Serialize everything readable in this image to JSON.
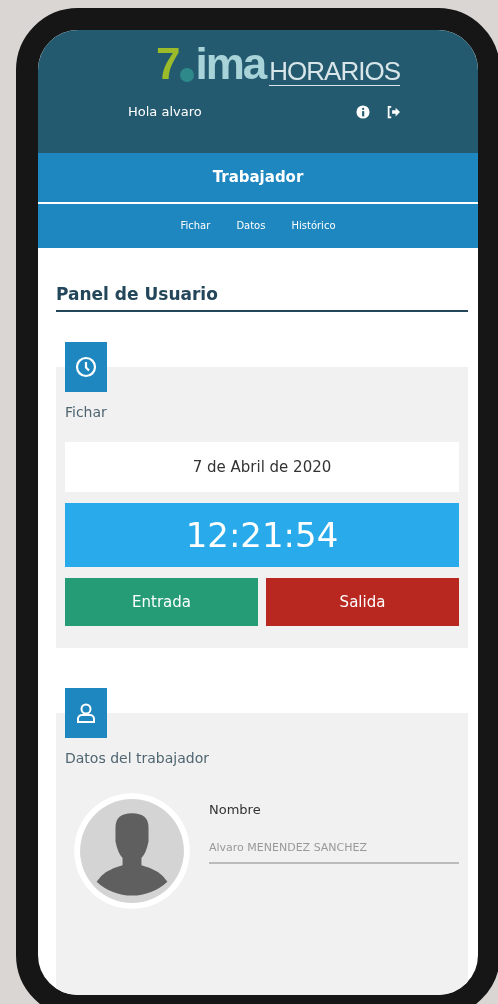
{
  "header": {
    "logo": {
      "mark": "7",
      "name": "ima",
      "product": "HORARIOS"
    },
    "greeting": "Hola alvaro"
  },
  "section_bar": {
    "title": "Trabajador",
    "nav": [
      "Fichar",
      "Datos",
      "Histórico"
    ]
  },
  "panel_title": "Panel de Usuario",
  "clock_card": {
    "title": "Fichar",
    "date": "7 de Abril de 2020",
    "time": "12:21:54",
    "buttons": [
      {
        "label": "Entrada",
        "kind": "in"
      },
      {
        "label": "Salida",
        "kind": "out"
      }
    ]
  },
  "worker_card": {
    "title": "Datos del trabajador",
    "field_label": "Nombre",
    "field_value": "Alvaro MENENDEZ SANCHEZ"
  }
}
